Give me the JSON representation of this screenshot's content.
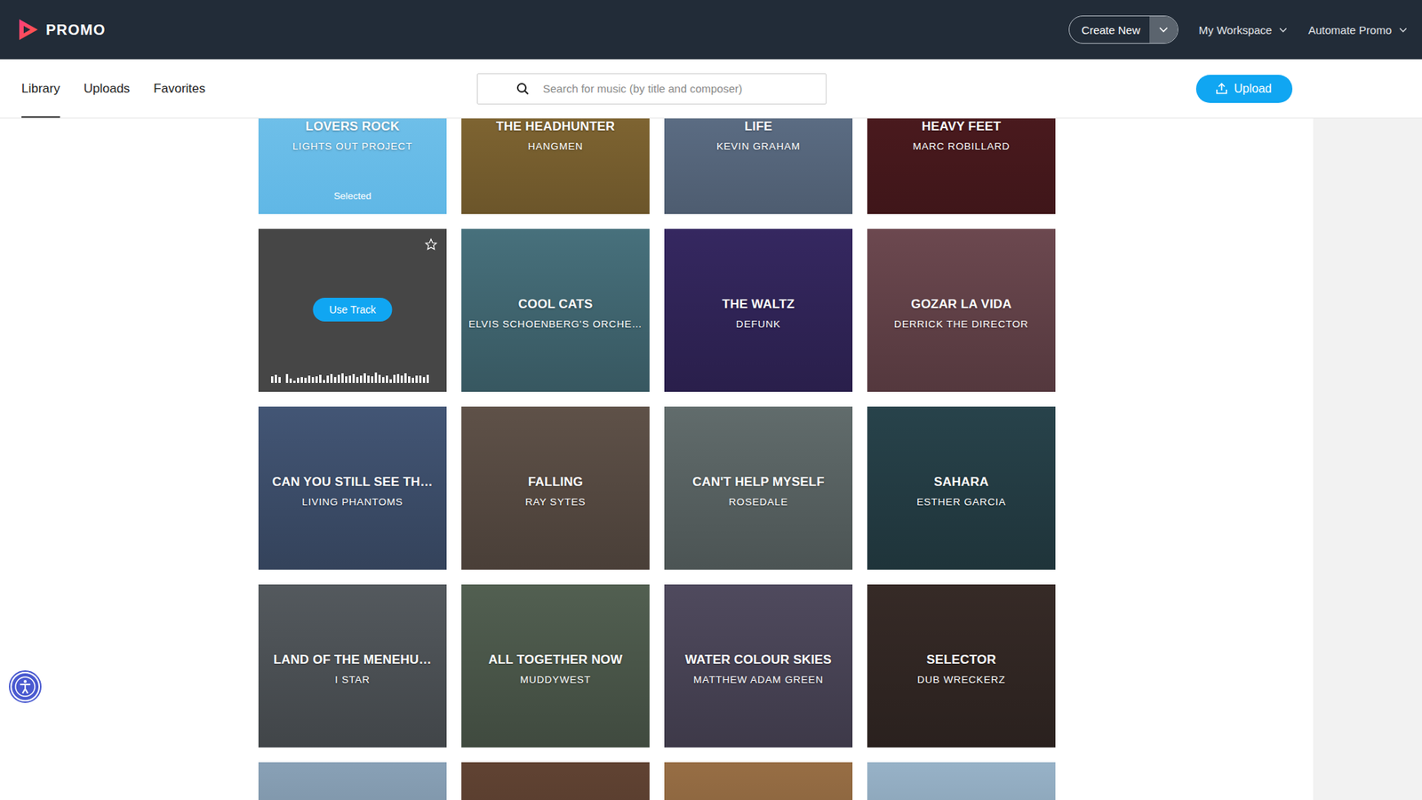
{
  "header": {
    "logo": "PROMO",
    "create_button": "Create New",
    "menus": [
      {
        "label": "My Workspace"
      },
      {
        "label": "Automate Promo"
      }
    ]
  },
  "tabs": [
    {
      "label": "Library",
      "selected": true
    },
    {
      "label": "Uploads",
      "selected": false
    },
    {
      "label": "Favorites",
      "selected": false
    }
  ],
  "search": {
    "placeholder": "Search for music (by title and composer)"
  },
  "upload_button": "Upload",
  "tracks": [
    {
      "title": "LOVERS ROCK",
      "artist": "LIGHTS OUT PROJECT",
      "selected": true,
      "hovered": false,
      "badge": "Selected",
      "color": "#6cbfe9"
    },
    {
      "title": "THE HEADHUNTER",
      "artist": "HANGMEN",
      "selected": false,
      "hovered": false,
      "color": "#9a7a3c"
    },
    {
      "title": "LIFE",
      "artist": "KEVIN GRAHAM",
      "selected": false,
      "hovered": false,
      "color": "#6f84a0"
    },
    {
      "title": "HEAVY FEET",
      "artist": "MARC ROBILLARD",
      "selected": false,
      "hovered": false,
      "color": "#5a1f24"
    },
    {
      "selected": false,
      "hovered": true,
      "favorite": false,
      "use_button": "Use Track",
      "color": "#6c6c6c",
      "waveform": [
        0.55,
        0.7,
        0.5,
        0.0,
        0.75,
        0.35,
        0.2,
        0.45,
        0.5,
        0.45,
        0.6,
        0.5,
        0.55,
        0.7,
        0.25,
        0.6,
        0.75,
        0.5,
        0.7,
        0.8,
        0.55,
        0.6,
        0.75,
        0.5,
        0.65,
        0.8,
        0.6,
        0.55,
        0.85,
        0.7,
        0.5,
        0.6,
        0.3,
        0.7,
        0.75,
        0.6,
        0.8,
        0.55,
        0.45,
        0.65,
        0.6,
        0.5,
        0.7
      ]
    },
    {
      "title": "COOL CATS",
      "artist": "ELVIS SCHOENBERG'S ORCHE…",
      "selected": false,
      "hovered": false,
      "color": "#4f7d8a"
    },
    {
      "title": "THE WALTZ",
      "artist": "DEFUNK",
      "selected": false,
      "hovered": false,
      "color": "#3b2c6b"
    },
    {
      "title": "GOZAR LA VIDA",
      "artist": "DERRICK THE DIRECTOR",
      "selected": false,
      "hovered": false,
      "color": "#785058"
    },
    {
      "title": "CAN YOU STILL SEE TH…",
      "artist": "LIVING PHANTOMS",
      "selected": false,
      "hovered": false,
      "color": "#4a5f82"
    },
    {
      "title": "FALLING",
      "artist": "RAY SYTES",
      "selected": false,
      "hovered": false,
      "color": "#695a50"
    },
    {
      "title": "CAN'T HELP MYSELF",
      "artist": "ROSEDALE",
      "selected": false,
      "hovered": false,
      "color": "#6c7878"
    },
    {
      "title": "SAHARA",
      "artist": "ESTHER GARCIA",
      "selected": false,
      "hovered": false,
      "color": "#2c4a53"
    },
    {
      "title": "LAND OF THE MENEHU…",
      "artist": "I STAR",
      "selected": false,
      "hovered": false,
      "color": "#5d6368"
    },
    {
      "title": "ALL TOGETHER NOW",
      "artist": "MUDDYWEST",
      "selected": false,
      "hovered": false,
      "color": "#5b6a5a"
    },
    {
      "title": "WATER COLOUR SKIES",
      "artist": "MATTHEW ADAM GREEN",
      "selected": false,
      "hovered": false,
      "color": "#585268"
    },
    {
      "title": "SELECTOR",
      "artist": "DUB WRECKERZ",
      "selected": false,
      "hovered": false,
      "color": "#3c2f2b"
    },
    {
      "selected": false,
      "hovered": false,
      "color": "#98b3cb"
    },
    {
      "selected": false,
      "hovered": false,
      "color": "#6b4a38"
    },
    {
      "selected": false,
      "hovered": false,
      "color": "#a87a4c"
    },
    {
      "selected": false,
      "hovered": false,
      "color": "#a8c6de"
    }
  ]
}
